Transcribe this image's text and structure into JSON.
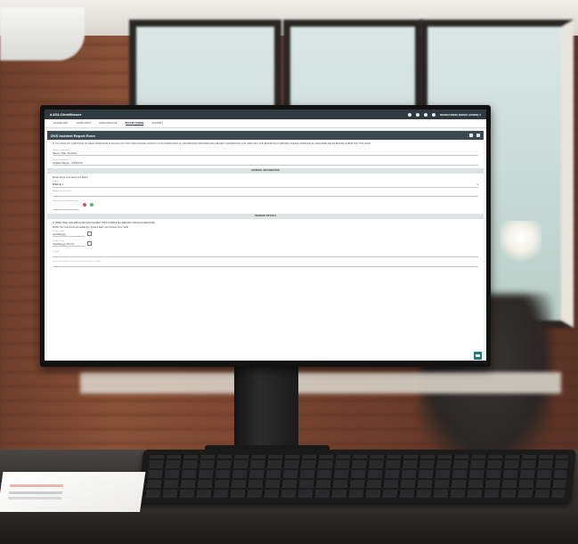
{
  "app": {
    "title": "d.ADA ClientMeasure",
    "user": "DEMOADMIN",
    "user_suffix": "(DEMO ADMIN) ▾"
  },
  "nav": {
    "tabs": [
      "DASHBOARD",
      "COMPLAINTS",
      "PERFORMANCE",
      "REPORT FORMS",
      "SUPPORT"
    ],
    "active_tab": "REPORT FORMS"
  },
  "form": {
    "title": "DVS Incident Report Form",
    "instructions": "IF YOU HAVE ANY QUESTIONS OR NEED ASSISTANCE IN FILLING OUT THIS FORM, PLEASE CONTACT YOUR SUPERVISOR. ALL INFORMATION PROVIDED WILL BE KEPT CONFIDENTIAL AND USED ONLY FOR REPORTING PURPOSES. PLEASE COMPLETE ALL REQUIRED FIELDS BEFORE SUBMITTING THIS FORM.",
    "fields": [
      {
        "label": "Contact Information",
        "value": "Name / Title / Number"
      },
      {
        "label": "Report Information",
        "value": "Incident Report - DVS/CVS"
      }
    ],
    "section_general": "GENERAL INFORMATION",
    "general_note": "Please tell us more about your facility",
    "facility_label": "Facility",
    "facility_value": "Building 1",
    "facility_arrow": "▾",
    "additional_label": "Additional Information",
    "upload_label": "Upload Document/Photo Here",
    "section_incident": "INCIDENT DETAILS",
    "incident_note_1": "IF MORE THAN ONE EMPLOYEE WAS INJURED, THEN COMPLETE A REPORT FOR EACH EMPLOYEE.",
    "incident_note_2": "NOTE: You must check and update the \"Incident Date\" and \"Incident Time\" fields.",
    "date_label": "Incident Date",
    "date_value": "mm/dd/yyyy",
    "time_label": "Incident Time",
    "time_value": "mm/dd/yyyy hh:mm",
    "location_label": "Location",
    "description_label": "Describe in detail the events that lead up to the incident"
  },
  "icons": {
    "topbar": [
      "info-icon",
      "refresh-icon",
      "bell-icon",
      "settings-icon"
    ],
    "header": [
      "share-icon",
      "home-icon"
    ],
    "fab": "chat-icon"
  },
  "colors": {
    "topbar": "#2e3a40",
    "header": "#3b4a52",
    "accent": "#1e7d73"
  }
}
